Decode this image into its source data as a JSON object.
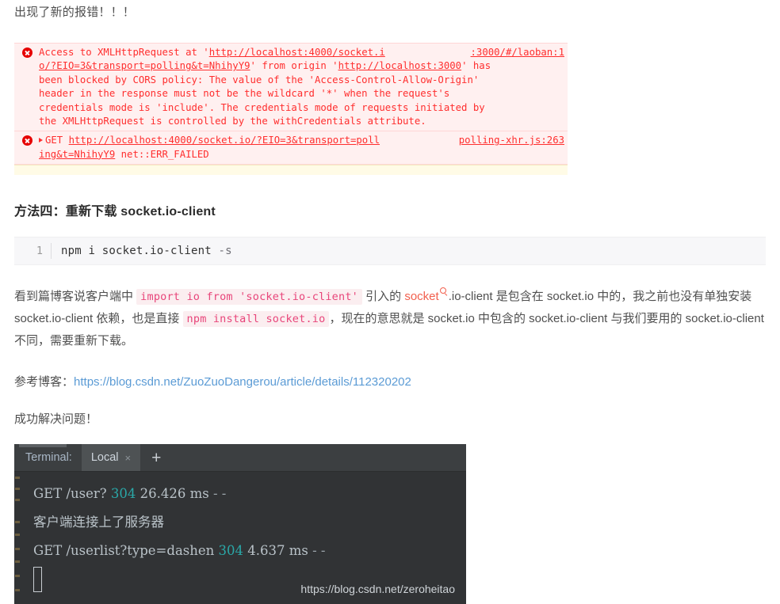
{
  "article": {
    "intro_line": "出现了新的报错！！！",
    "method_heading": "方法四：重新下载 socket.io-client",
    "reference_label": "参考博客：",
    "reference_url": "https://blog.csdn.net/ZuoZuoDangerou/article/details/112320202",
    "success_line": "成功解决问题！"
  },
  "console": {
    "error1": {
      "line1": "Access to XMLHttpRequest at 'http://localhost:4000/socket.i",
      "line1_plain_prefix": "Access to XMLHttpRequest at '",
      "line1_link": "http://localhost:4000/socket.i",
      "line2_link": "o/?EIO=3&transport=polling&t=NhihyY9",
      "line2_mid": "' from origin '",
      "line2_link2": "http://localhost:3000",
      "line2_tail": "' has",
      "line3": "been blocked by CORS policy: The value of the 'Access-Control-Allow-Origin'",
      "line4": "header in the response must not be the wildcard '*' when the request's",
      "line5": "credentials mode is 'include'. The credentials mode of requests initiated by",
      "line6": "the XMLHttpRequest is controlled by the withCredentials attribute.",
      "source": ":3000/#/laoban:1"
    },
    "error2": {
      "method": "GET",
      "url_line1": "http://localhost:4000/socket.io/?EIO=3&transport=poll",
      "url_line2": "ing&t=NhihyY9",
      "status": "net::ERR_FAILED",
      "source": "polling-xhr.js:263"
    }
  },
  "code_block": {
    "line_number": "1",
    "command": "npm i socket.io-client",
    "flag": "-s"
  },
  "paragraph": {
    "seg1": "看到篇博客说客户端中 ",
    "code1": "import io from 'socket.io-client'",
    "seg2": " 引入的 ",
    "highlight": "socket",
    "seg3": ".io-client 是包含在 socket.io 中的，我之前也没有单独安装 socket.io-client 依赖，也是直接 ",
    "code2": "npm install socket.io",
    "seg4": "，现在的意思就是 socket.io 中包含的 socket.io-client 与我们要用的 socket.io-client 不同，需要重新下载。"
  },
  "terminal": {
    "label": "Terminal:",
    "tab_name": "Local",
    "tab_close": "×",
    "add_tab": "+",
    "lines": [
      {
        "prefix": "GET /user? ",
        "status": "304",
        "timing": " 26.426 ms ",
        "tail": "- -"
      },
      {
        "text": "客户端连接上了服务器"
      },
      {
        "prefix": "GET /userlist?type=dashen ",
        "status": "304",
        "timing": " 4.637 ms ",
        "tail": "- -"
      }
    ],
    "watermark": "https://blog.csdn.net/zeroheitao"
  },
  "colors": {
    "error_text": "#ff2e2e",
    "error_bg": "#fff0f0",
    "link_blue": "#5b9bd5",
    "inline_code": "#e8457a",
    "highlight_orange": "#f2604e",
    "terminal_bg": "#313335",
    "terminal_status": "#2aa8a8"
  }
}
